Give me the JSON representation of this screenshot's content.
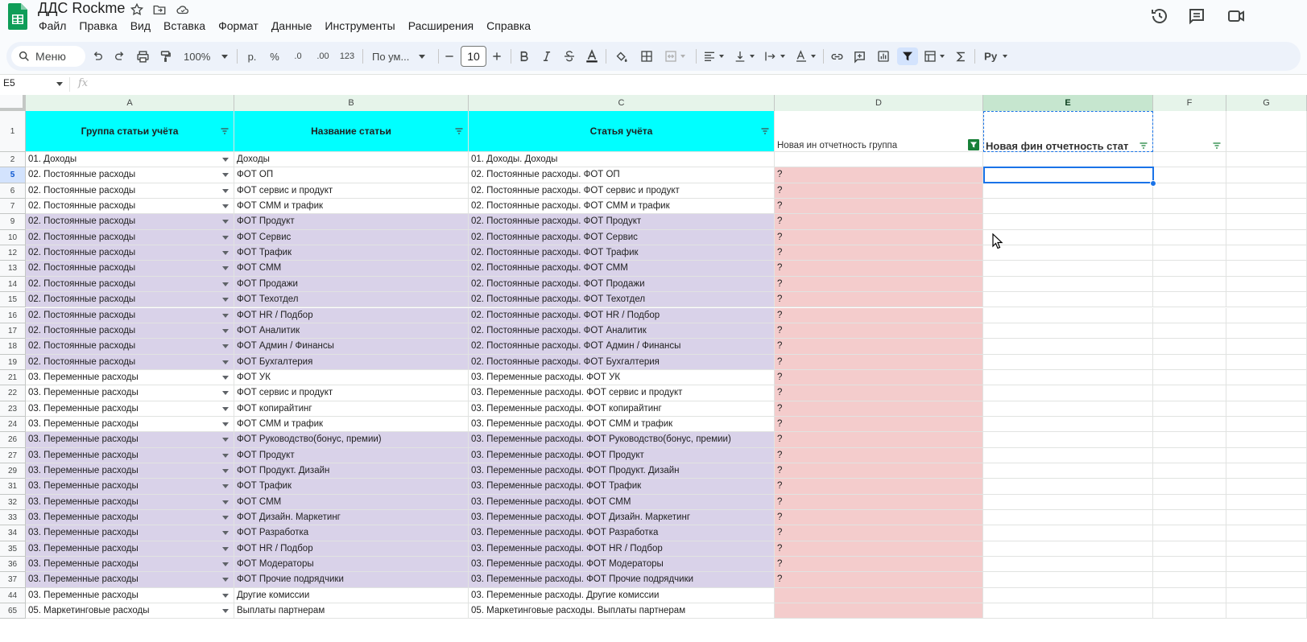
{
  "app": {
    "title": "ДДС Rockme",
    "brand_color": "#0f9d58"
  },
  "menu": [
    "Файл",
    "Правка",
    "Вид",
    "Вставка",
    "Формат",
    "Данные",
    "Инструменты",
    "Расширения",
    "Справка"
  ],
  "toolbar": {
    "search_label": "Меню",
    "zoom": "100%",
    "currency": "р.",
    "percent": "%",
    "decrease_decimal": ".0",
    "increase_decimal": ".00",
    "number_format": "123",
    "font_family": "По ум...",
    "font_size": "10",
    "icons": [
      "undo-icon",
      "redo-icon",
      "print-icon",
      "paint-format-icon",
      "bold-icon",
      "italic-icon",
      "strikethrough-icon",
      "text-color-icon",
      "fill-color-icon",
      "borders-icon",
      "merge-icon",
      "align-icon",
      "valign-icon",
      "wrap-icon",
      "rotate-icon",
      "link-icon",
      "comment-icon",
      "chart-icon",
      "filter-icon",
      "filter-views-icon",
      "functions-icon",
      "input-tools-icon"
    ]
  },
  "formula_bar": {
    "cell_ref": "E5",
    "fx": "fx",
    "value": ""
  },
  "columns": [
    "A",
    "B",
    "C",
    "D",
    "E",
    "F",
    "G"
  ],
  "selected_column": "E",
  "selected_row": "5",
  "header_row": {
    "row_number": "1",
    "a": "Группа статьи учёта",
    "b": "Название статьи",
    "c": "Статья учёта",
    "d": "Новая ин отчетность группа",
    "e": "Новая фин отчетность стат"
  },
  "rows": [
    {
      "n": "2",
      "a": "01. Доходы",
      "b": "Доходы",
      "c": "01. Доходы. Доходы",
      "d": "",
      "fill": "white",
      "dfill": "white"
    },
    {
      "n": "5",
      "a": "02. Постоянные расходы",
      "b": "ФОТ ОП",
      "c": "02. Постоянные расходы. ФОТ ОП",
      "d": "?",
      "fill": "white",
      "dfill": "pink"
    },
    {
      "n": "6",
      "a": "02. Постоянные расходы",
      "b": "ФОТ сервис и продукт",
      "c": "02. Постоянные расходы. ФОТ сервис и продукт",
      "d": "?",
      "fill": "white",
      "dfill": "pink"
    },
    {
      "n": "7",
      "a": "02. Постоянные расходы",
      "b": "ФОТ СММ и трафик",
      "c": "02. Постоянные расходы. ФОТ СММ и трафик",
      "d": "?",
      "fill": "white",
      "dfill": "pink"
    },
    {
      "n": "9",
      "a": "02. Постоянные расходы",
      "b": "ФОТ Продукт",
      "c": "02. Постоянные расходы. ФОТ Продукт",
      "d": "?",
      "fill": "purple",
      "dfill": "pink"
    },
    {
      "n": "10",
      "a": "02. Постоянные расходы",
      "b": "ФОТ Сервис",
      "c": "02. Постоянные расходы. ФОТ Сервис",
      "d": "?",
      "fill": "purple",
      "dfill": "pink"
    },
    {
      "n": "12",
      "a": "02. Постоянные расходы",
      "b": "ФОТ Трафик",
      "c": "02. Постоянные расходы. ФОТ Трафик",
      "d": "?",
      "fill": "purple",
      "dfill": "pink"
    },
    {
      "n": "13",
      "a": "02. Постоянные расходы",
      "b": "ФОТ СММ",
      "c": "02. Постоянные расходы. ФОТ СММ",
      "d": "?",
      "fill": "purple",
      "dfill": "pink"
    },
    {
      "n": "14",
      "a": "02. Постоянные расходы",
      "b": "ФОТ Продажи",
      "c": "02. Постоянные расходы. ФОТ Продажи",
      "d": "?",
      "fill": "purple",
      "dfill": "pink"
    },
    {
      "n": "15",
      "a": "02. Постоянные расходы",
      "b": "ФОТ Техотдел",
      "c": "02. Постоянные расходы. ФОТ Техотдел",
      "d": "?",
      "fill": "purple",
      "dfill": "pink"
    },
    {
      "n": "16",
      "a": "02. Постоянные расходы",
      "b": "ФОТ HR / Подбор",
      "c": "02. Постоянные расходы. ФОТ HR / Подбор",
      "d": "?",
      "fill": "purple",
      "dfill": "pink"
    },
    {
      "n": "17",
      "a": "02. Постоянные расходы",
      "b": "ФОТ Аналитик",
      "c": "02. Постоянные расходы. ФОТ Аналитик",
      "d": "?",
      "fill": "purple",
      "dfill": "pink"
    },
    {
      "n": "18",
      "a": "02. Постоянные расходы",
      "b": "ФОТ Админ / Финансы",
      "c": "02. Постоянные расходы. ФОТ Админ / Финансы",
      "d": "?",
      "fill": "purple",
      "dfill": "pink"
    },
    {
      "n": "19",
      "a": "02. Постоянные расходы",
      "b": "ФОТ Бухгалтерия",
      "c": "02. Постоянные расходы. ФОТ Бухгалтерия",
      "d": "?",
      "fill": "purple",
      "dfill": "pink"
    },
    {
      "n": "21",
      "a": "03. Переменные расходы",
      "b": "ФОТ УК",
      "c": "03. Переменные расходы. ФОТ УК",
      "d": "?",
      "fill": "white",
      "dfill": "pink"
    },
    {
      "n": "22",
      "a": "03. Переменные расходы",
      "b": "ФОТ сервис и продукт",
      "c": "03. Переменные расходы. ФОТ сервис и продукт",
      "d": "?",
      "fill": "white",
      "dfill": "pink"
    },
    {
      "n": "23",
      "a": "03. Переменные расходы",
      "b": "ФОТ копирайтинг",
      "c": "03. Переменные расходы. ФОТ копирайтинг",
      "d": "?",
      "fill": "white",
      "dfill": "pink"
    },
    {
      "n": "24",
      "a": "03. Переменные расходы",
      "b": "ФОТ СММ и трафик",
      "c": "03. Переменные расходы. ФОТ СММ и трафик",
      "d": "?",
      "fill": "white",
      "dfill": "pink"
    },
    {
      "n": "26",
      "a": "03. Переменные расходы",
      "b": "ФОТ Руководство(бонус, премии)",
      "c": "03. Переменные расходы. ФОТ Руководство(бонус, премии)",
      "d": "?",
      "fill": "purple",
      "dfill": "pink"
    },
    {
      "n": "27",
      "a": "03. Переменные расходы",
      "b": "ФОТ Продукт",
      "c": "03. Переменные расходы. ФОТ Продукт",
      "d": "?",
      "fill": "purple",
      "dfill": "pink"
    },
    {
      "n": "29",
      "a": "03. Переменные расходы",
      "b": "ФОТ Продукт. Дизайн",
      "c": "03. Переменные расходы. ФОТ Продукт. Дизайн",
      "d": "?",
      "fill": "purple",
      "dfill": "pink"
    },
    {
      "n": "31",
      "a": "03. Переменные расходы",
      "b": "ФОТ Трафик",
      "c": "03. Переменные расходы. ФОТ Трафик",
      "d": "?",
      "fill": "purple",
      "dfill": "pink"
    },
    {
      "n": "32",
      "a": "03. Переменные расходы",
      "b": "ФОТ СММ",
      "c": "03. Переменные расходы. ФОТ СММ",
      "d": "?",
      "fill": "purple",
      "dfill": "pink"
    },
    {
      "n": "33",
      "a": "03. Переменные расходы",
      "b": "ФОТ Дизайн. Маркетинг",
      "c": "03. Переменные расходы. ФОТ Дизайн. Маркетинг",
      "d": "?",
      "fill": "purple",
      "dfill": "pink"
    },
    {
      "n": "34",
      "a": "03. Переменные расходы",
      "b": "ФОТ Разработка",
      "c": "03. Переменные расходы. ФОТ Разработка",
      "d": "?",
      "fill": "purple",
      "dfill": "pink"
    },
    {
      "n": "35",
      "a": "03. Переменные расходы",
      "b": "ФОТ HR / Подбор",
      "c": "03. Переменные расходы. ФОТ HR / Подбор",
      "d": "?",
      "fill": "purple",
      "dfill": "pink"
    },
    {
      "n": "36",
      "a": "03. Переменные расходы",
      "b": "ФОТ Модераторы",
      "c": "03. Переменные расходы. ФОТ Модераторы",
      "d": "?",
      "fill": "purple",
      "dfill": "pink"
    },
    {
      "n": "37",
      "a": "03. Переменные расходы",
      "b": "ФОТ Прочие подрядчики",
      "c": "03. Переменные расходы. ФОТ Прочие подрядчики",
      "d": "?",
      "fill": "purple",
      "dfill": "pink"
    },
    {
      "n": "44",
      "a": "03. Переменные расходы",
      "b": "Другие комиссии",
      "c": "03. Переменные расходы. Другие комиссии",
      "d": "",
      "fill": "white",
      "dfill": "pink"
    },
    {
      "n": "65",
      "a": "05. Маркетинговые расходы",
      "b": "Выплаты партнерам",
      "c": "05. Маркетинговые расходы. Выплаты партнерам",
      "d": "",
      "fill": "white",
      "dfill": "pink"
    }
  ],
  "colors": {
    "header_fill": "#00ffff",
    "purple_fill": "#d9d2e9",
    "pink_fill": "#f4cccc",
    "selection": "#1a73e8",
    "filter_active": "#188038"
  }
}
